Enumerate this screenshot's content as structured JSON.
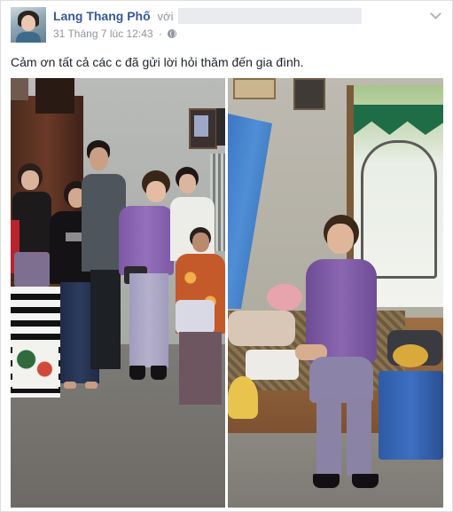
{
  "post": {
    "author": "Lang Thang Phố",
    "with_label": "với",
    "timestamp": "31 Tháng 7 lúc 12:43",
    "privacy_icon": "globe-icon",
    "menu_icon": "chevron-down-icon",
    "caption": "Cảm ơn tất cả các c đã gửi lời hỏi thăm đến gia đình."
  },
  "photos": {
    "left_icon": "photo",
    "right_icon": "photo"
  }
}
